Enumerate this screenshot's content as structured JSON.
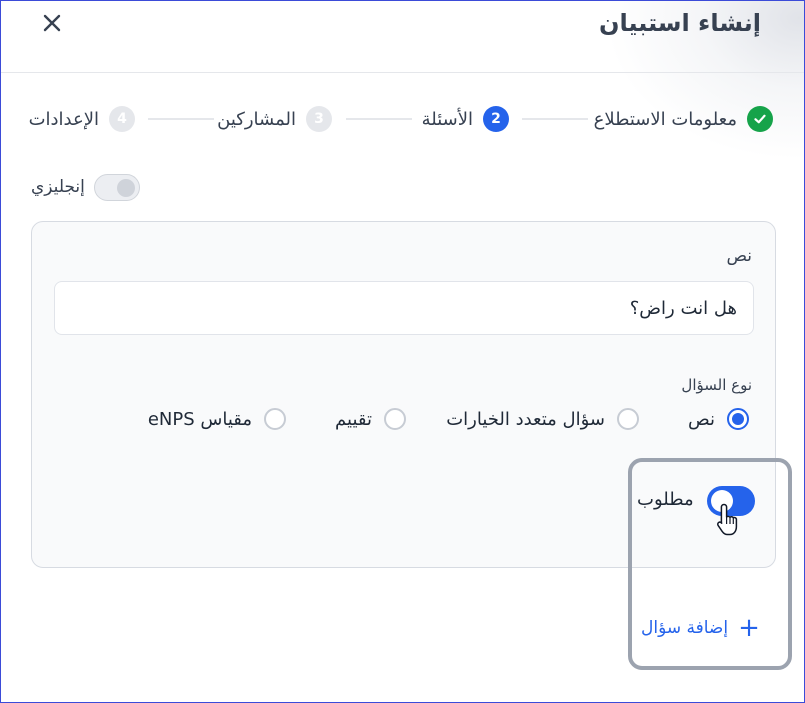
{
  "dialog": {
    "title": "إنشاء استبيان",
    "close_icon": "close-icon"
  },
  "stepper": {
    "steps": [
      {
        "number": "1",
        "label": "معلومات الاستطلاع",
        "state": "done"
      },
      {
        "number": "2",
        "label": "الأسئلة",
        "state": "active"
      },
      {
        "number": "3",
        "label": "المشاركين",
        "state": "idle"
      },
      {
        "number": "4",
        "label": "الإعدادات",
        "state": "idle"
      }
    ]
  },
  "language_toggle": {
    "label": "إنجليزي",
    "on": false
  },
  "question": {
    "text_label": "نص",
    "text_value": "هل انت راض؟",
    "type_label": "نوع السؤال",
    "types": [
      {
        "label": "نص",
        "selected": true
      },
      {
        "label": "سؤال متعدد الخيارات",
        "selected": false
      },
      {
        "label": "تقييم",
        "selected": false
      },
      {
        "label": "مقياس eNPS",
        "selected": false
      }
    ],
    "required_label": "مطلوب",
    "required_on": true
  },
  "actions": {
    "add_question_label": "إضافة سؤال",
    "add_icon": "+"
  },
  "colors": {
    "accent": "#2563eb",
    "done": "#16a34a",
    "idle": "#e5e7eb",
    "highlight": "#9ca3af"
  }
}
